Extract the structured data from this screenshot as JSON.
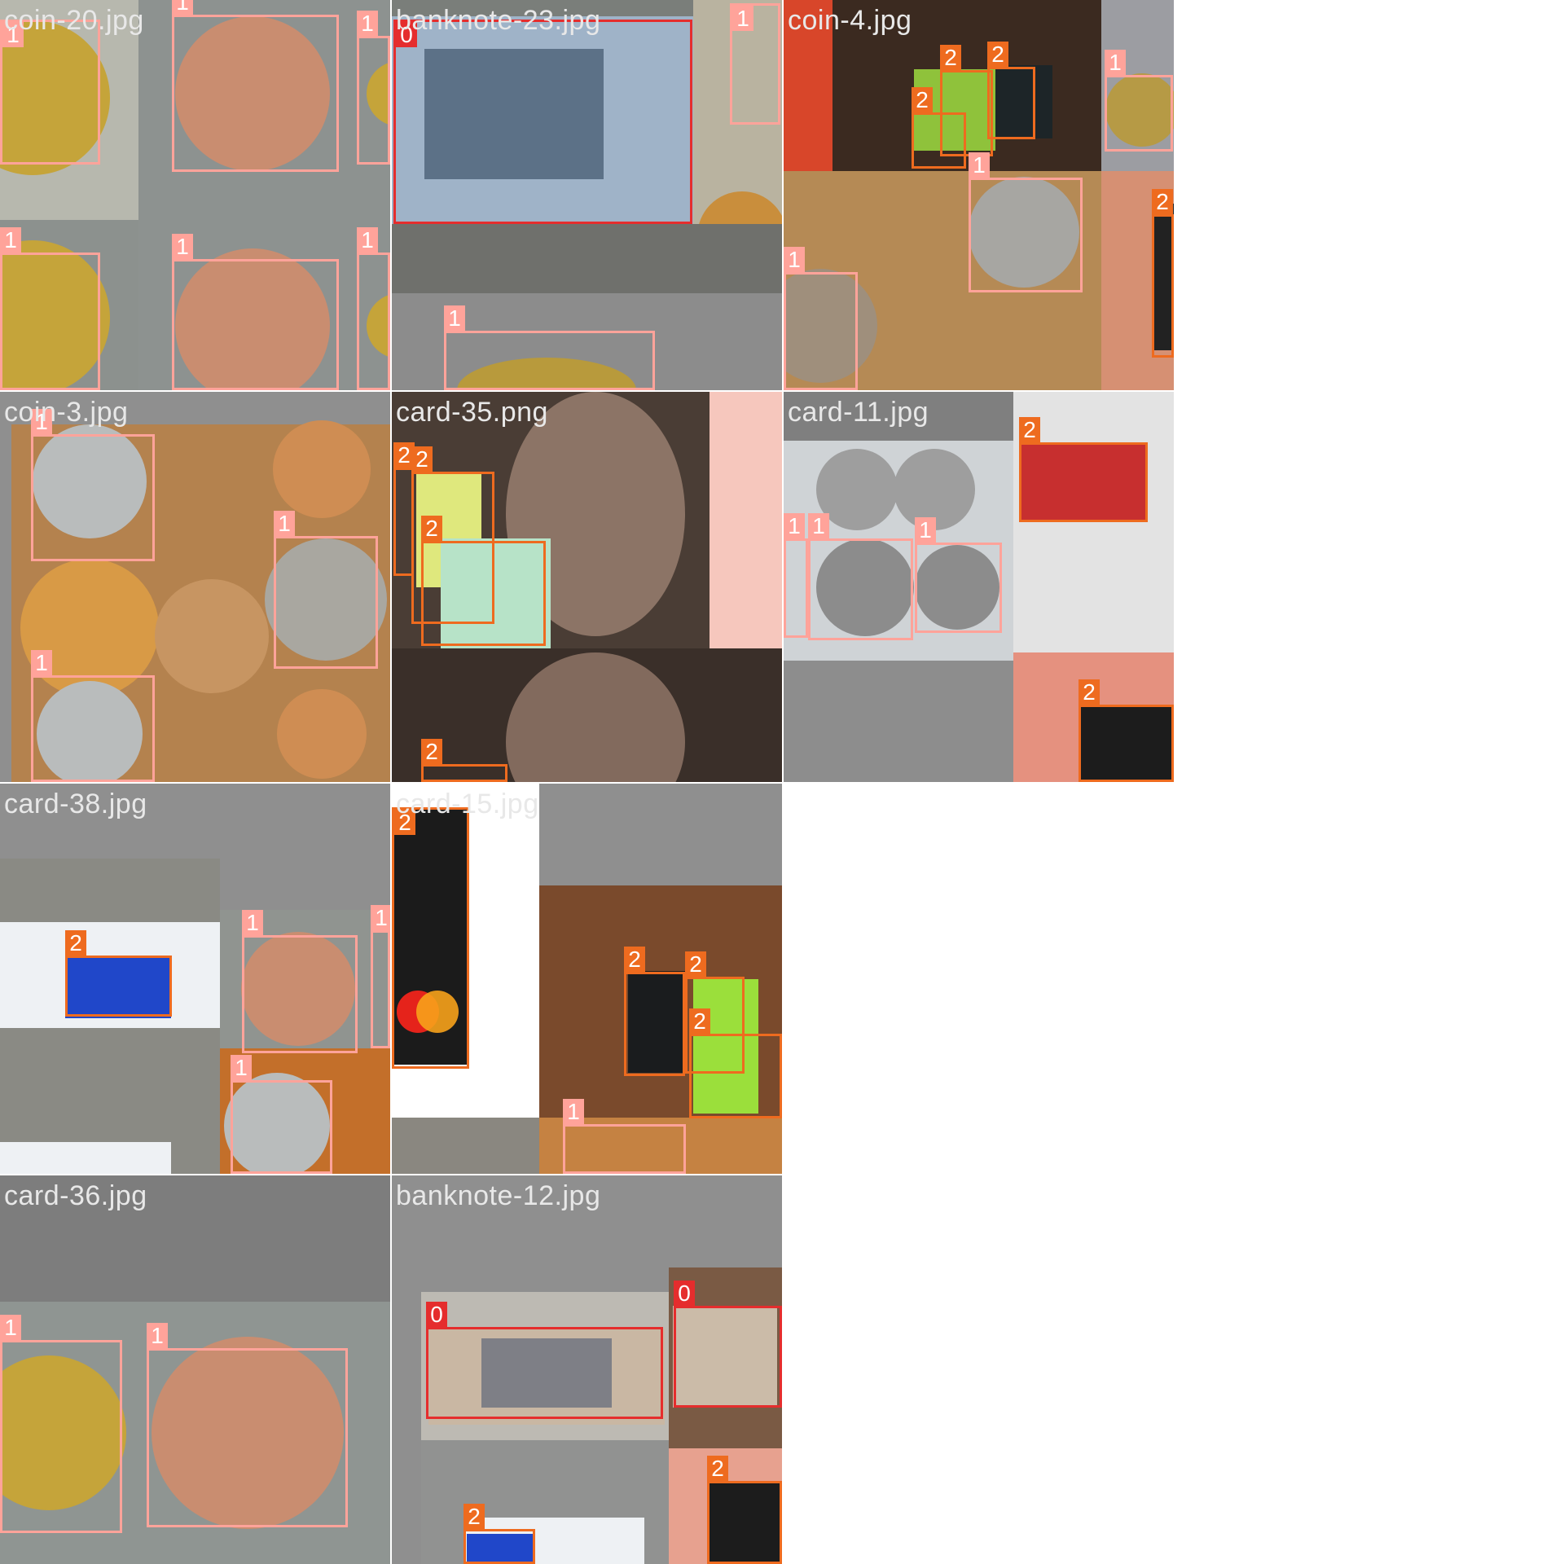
{
  "tiles": [
    {
      "title": "coin-20.jpg"
    },
    {
      "title": "banknote-23.jpg"
    },
    {
      "title": "coin-4.jpg"
    },
    {
      "title": "coin-3.jpg"
    },
    {
      "title": "card-35.png"
    },
    {
      "title": "card-11.jpg"
    },
    {
      "title": "card-38.jpg"
    },
    {
      "title": "card-15.jpg"
    },
    {
      "title": "card-36.jpg"
    },
    {
      "title": "banknote-12.jpg"
    }
  ],
  "class_labels": {
    "banknote": "0",
    "coin": "1",
    "card": "2"
  },
  "class_colors": {
    "0": "#e52d2d",
    "1": "#ffa39a",
    "2": "#ee6b1f"
  }
}
